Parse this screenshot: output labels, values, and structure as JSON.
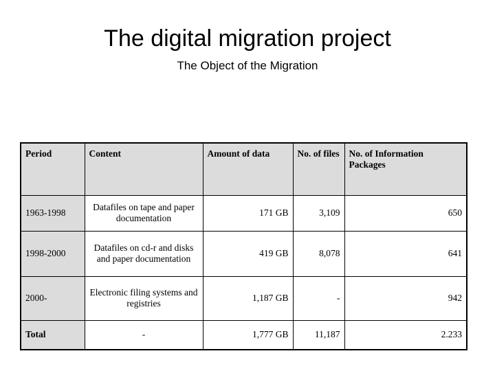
{
  "slide": {
    "title": "The digital migration project",
    "subtitle": "The Object of the Migration"
  },
  "table": {
    "headers": {
      "period": "Period",
      "content": "Content",
      "amount": "Amount of data",
      "files": "No. of files",
      "packages": "No. of Information Packages"
    },
    "rows": [
      {
        "period": "1963-1998",
        "content": "Datafiles on tape and paper documentation",
        "amount": "171 GB",
        "files": "3,109",
        "packages": "650"
      },
      {
        "period": "1998-2000",
        "content": "Datafiles on cd-r and disks and paper documentation",
        "amount": "419 GB",
        "files": "8,078",
        "packages": "641"
      },
      {
        "period": "2000-",
        "content": "Electronic filing systems and registries",
        "amount": "1,187 GB",
        "files": "-",
        "packages": "942"
      },
      {
        "period": "Total",
        "content": "-",
        "amount": "1,777 GB",
        "files": "11,187",
        "packages": "2.233"
      }
    ]
  },
  "colors": {
    "header_background": "#dcdcdc",
    "cell_background": "#ffffff",
    "border": "#000000",
    "text": "#000000"
  }
}
